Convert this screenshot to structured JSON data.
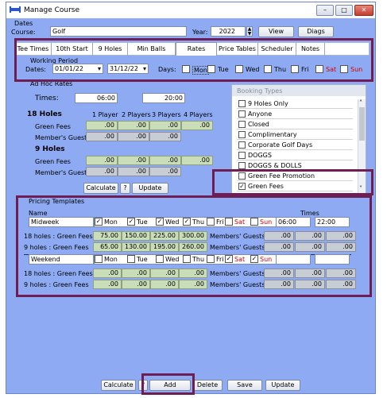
{
  "window": {
    "title": "Manage Course",
    "minimize": "–",
    "maximize": "□",
    "close": "✕"
  },
  "dates_group": {
    "label": "Dates",
    "course_label": "Course:",
    "course_value": "Golf",
    "year_label": "Year:",
    "year_value": "2022",
    "view_button": "View",
    "diags_button": "Diags"
  },
  "tabs": [
    "Tee Times",
    "10th Start",
    "9 Holes",
    "Min Balls",
    "Rates",
    "Price Tables",
    "Scheduler",
    "Notes"
  ],
  "active_tab": "Rates",
  "working_period": {
    "label": "Working Period",
    "dates_label": "Dates:",
    "from": "01/01/22",
    "to": "31/12/22",
    "days_label": "Days:",
    "days": [
      {
        "name": "Mon",
        "checked": false,
        "weekend": false
      },
      {
        "name": "Tue",
        "checked": false,
        "weekend": false
      },
      {
        "name": "Wed",
        "checked": false,
        "weekend": false
      },
      {
        "name": "Thu",
        "checked": false,
        "weekend": false
      },
      {
        "name": "Fri",
        "checked": false,
        "weekend": false
      },
      {
        "name": "Sat",
        "checked": false,
        "weekend": true
      },
      {
        "name": "Sun",
        "checked": false,
        "weekend": true
      }
    ]
  },
  "adhoc": {
    "label": "Ad Hoc Rates",
    "times_label": "Times:",
    "time_from": "06:00",
    "time_to": "20:00",
    "h18_label": "18 Holes",
    "h9_label": "9  Holes",
    "player_headers": [
      "1 Player",
      "2 Players",
      "3 Players",
      "4 Players"
    ],
    "green_fees_label": "Green Fees",
    "members_guest_label": "Member's Guest",
    "h18_green": [
      ".00",
      ".00",
      ".00",
      ".00"
    ],
    "h18_member": [
      ".00",
      ".00",
      ".00"
    ],
    "h9_green": [
      ".00",
      ".00",
      ".00",
      ".00"
    ],
    "h9_member": [
      ".00",
      ".00",
      ".00"
    ],
    "calculate_button": "Calculate",
    "help_button": "?",
    "update_button": "Update"
  },
  "booking_types": {
    "label": "Booking Types",
    "items": [
      {
        "name": "9 Holes Only",
        "checked": false
      },
      {
        "name": "Anyone",
        "checked": false
      },
      {
        "name": "Closed",
        "checked": false
      },
      {
        "name": "Complimentary",
        "checked": false
      },
      {
        "name": "Corporate Golf Days",
        "checked": false
      },
      {
        "name": "DOGGS",
        "checked": false
      },
      {
        "name": "DOGGS & DOLLS",
        "checked": false
      },
      {
        "name": "Green Fee Promotion",
        "checked": false
      },
      {
        "name": "Green Fees",
        "checked": true
      }
    ]
  },
  "pricing": {
    "label": "Pricing Templates",
    "name_header": "Name",
    "times_header": "Times",
    "members_guests_label": "Members' Guests",
    "templates": [
      {
        "name": "Midweek",
        "days": [
          {
            "name": "Mon",
            "checked": true,
            "weekend": false
          },
          {
            "name": "Tue",
            "checked": true,
            "weekend": false
          },
          {
            "name": "Wed",
            "checked": true,
            "weekend": false
          },
          {
            "name": "Thu",
            "checked": true,
            "weekend": false
          },
          {
            "name": "Fri",
            "checked": false,
            "weekend": false
          },
          {
            "name": "Sat",
            "checked": false,
            "weekend": true
          },
          {
            "name": "Sun",
            "checked": false,
            "weekend": true
          }
        ],
        "time_from": "06:00",
        "time_to": "22:00",
        "row18_label": "18 holes : Green Fees",
        "row18": [
          "75.00",
          "150.00",
          "225.00",
          "300.00"
        ],
        "row18_guests": [
          ".00",
          ".00",
          ".00"
        ],
        "row9_label": "9 holes : Green Fees",
        "row9": [
          "65.00",
          "130.00",
          "195.00",
          "260.00"
        ],
        "row9_guests": [
          ".00",
          ".00",
          ".00"
        ]
      },
      {
        "name": "Weekend",
        "days": [
          {
            "name": "Mon",
            "checked": false,
            "weekend": false
          },
          {
            "name": "Tue",
            "checked": false,
            "weekend": false
          },
          {
            "name": "Wed",
            "checked": false,
            "weekend": false
          },
          {
            "name": "Thu",
            "checked": false,
            "weekend": false
          },
          {
            "name": "Fri",
            "checked": false,
            "weekend": false
          },
          {
            "name": "Sat",
            "checked": true,
            "weekend": true
          },
          {
            "name": "Sun",
            "checked": true,
            "weekend": true
          }
        ],
        "time_from": "",
        "time_to": "",
        "row18_label": "18 holes : Green Fees",
        "row18": [
          ".00",
          ".00",
          ".00",
          ".00"
        ],
        "row18_guests": [
          ".00",
          ".00",
          ".00"
        ],
        "row9_label": "9 holes : Green Fees",
        "row9": [
          ".00",
          ".00",
          ".00",
          ".00"
        ],
        "row9_guests": [
          ".00",
          ".00",
          ".00"
        ]
      }
    ]
  },
  "bottom_bar": {
    "calculate": "Calculate",
    "help": "?",
    "add": "Add",
    "delete": "Delete",
    "save": "Save",
    "update": "Update"
  },
  "colors": {
    "highlight": "#6e1e52",
    "panel": "#8eaaf3",
    "value_field": "#c9ddb9",
    "weekend_text": "#d00000"
  }
}
